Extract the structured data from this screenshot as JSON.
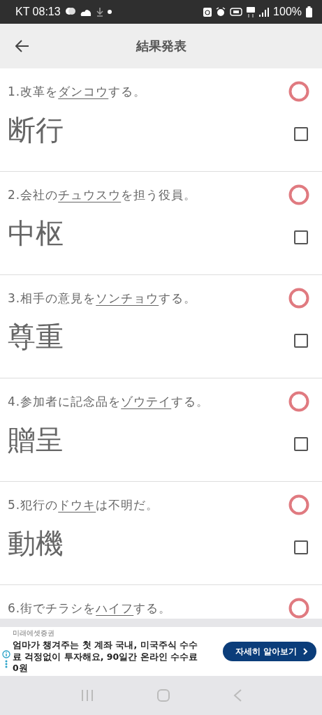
{
  "status_bar": {
    "carrier_time": "KT 08:13",
    "battery": "100%"
  },
  "app_bar": {
    "title": "結果発表"
  },
  "questions": [
    {
      "number": "1.",
      "before": "改革を",
      "underlined": "ダンコウ",
      "after": "する。",
      "answer": "断行",
      "correct": true,
      "checked": false
    },
    {
      "number": "2.",
      "before": "会社の",
      "underlined": "チュウスウ",
      "after": "を担う役員。",
      "answer": "中枢",
      "correct": true,
      "checked": false
    },
    {
      "number": "3.",
      "before": "相手の意見を",
      "underlined": "ソンチョウ",
      "after": "する。",
      "answer": "尊重",
      "correct": true,
      "checked": false
    },
    {
      "number": "4.",
      "before": "参加者に記念品を",
      "underlined": "ゾウテイ",
      "after": "する。",
      "answer": "贈呈",
      "correct": true,
      "checked": false
    },
    {
      "number": "5.",
      "before": "犯行の",
      "underlined": "ドウキ",
      "after": "は不明だ。",
      "answer": "動機",
      "correct": true,
      "checked": false
    },
    {
      "number": "6.",
      "before": "街でチラシを",
      "underlined": "ハイフ",
      "after": "する。",
      "correct": true
    }
  ],
  "ad": {
    "advertiser": "미래에셋증권",
    "text": "엄마가 챙겨주는 첫 계좌 국내, 미국주식 수수료 걱정없이 투자해요, 90일간 온라인 수수료 0원",
    "button": "자세히 알아보기"
  }
}
